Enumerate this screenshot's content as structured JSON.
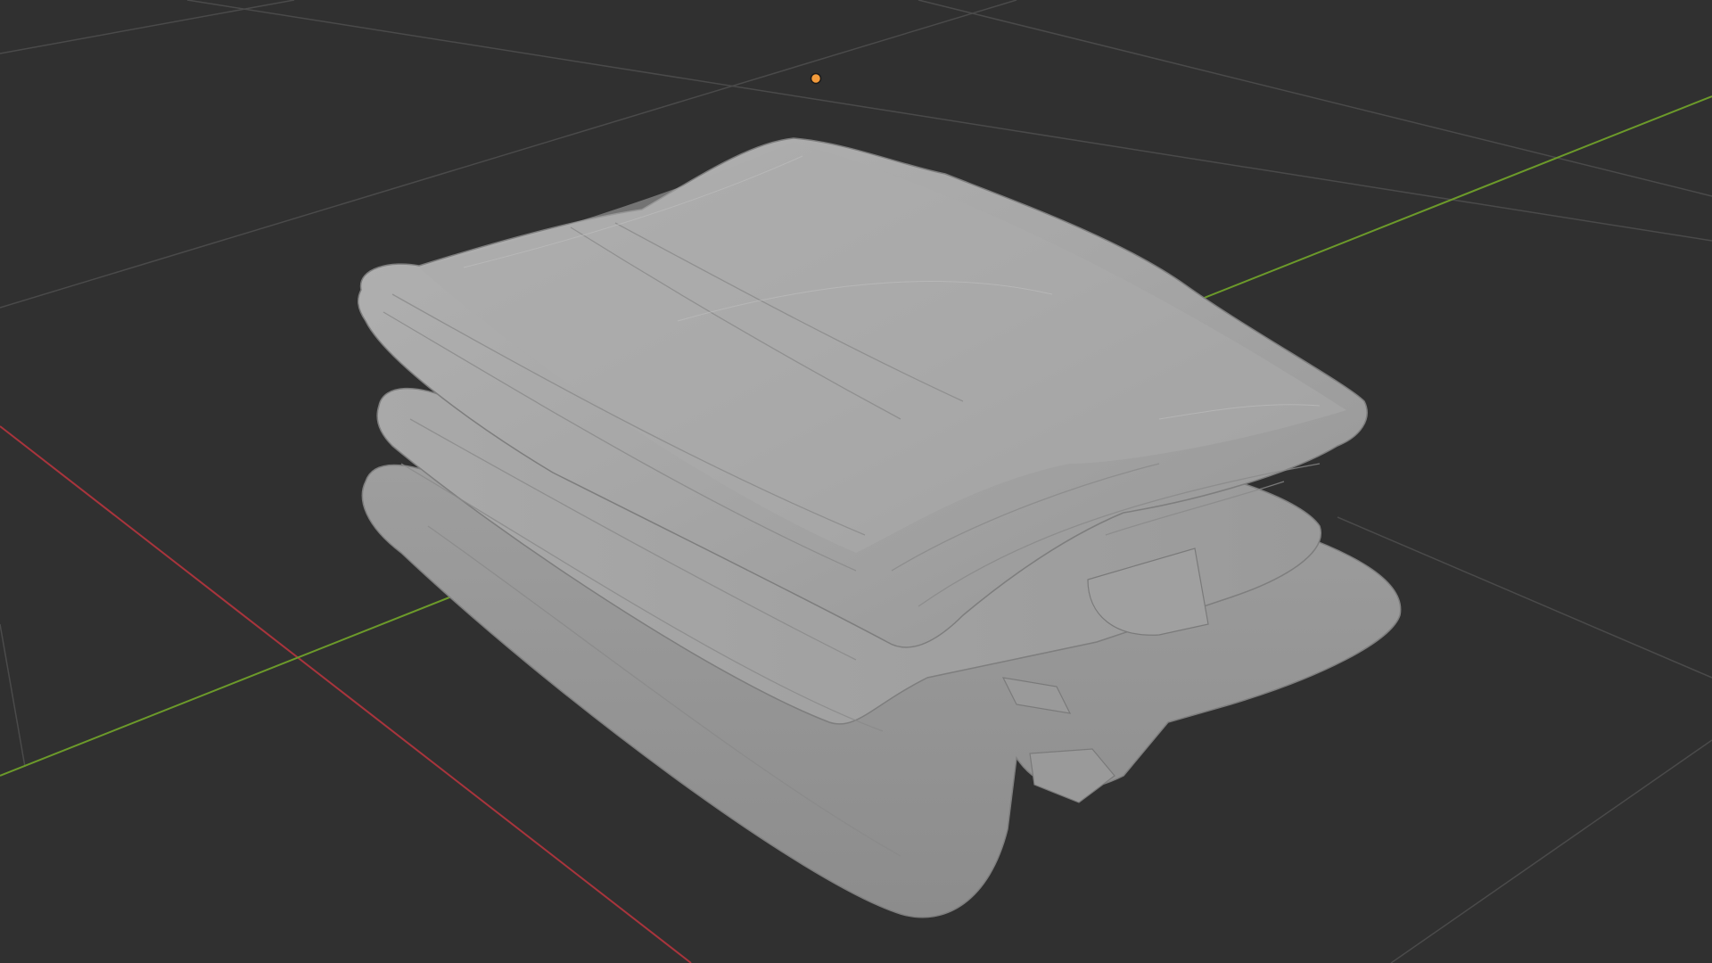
{
  "app": {
    "view": "3d-viewport",
    "shading": "solid"
  },
  "viewport": {
    "background_color": "#303030",
    "grid_color": "#4a4a4a",
    "x_axis_color": "#a8343c",
    "y_axis_color": "#6c9a2a",
    "origin_marker_color": "#f29a3b"
  },
  "scene": {
    "object": "folded-cloth-stack",
    "material_color": "#a3a3a3"
  }
}
